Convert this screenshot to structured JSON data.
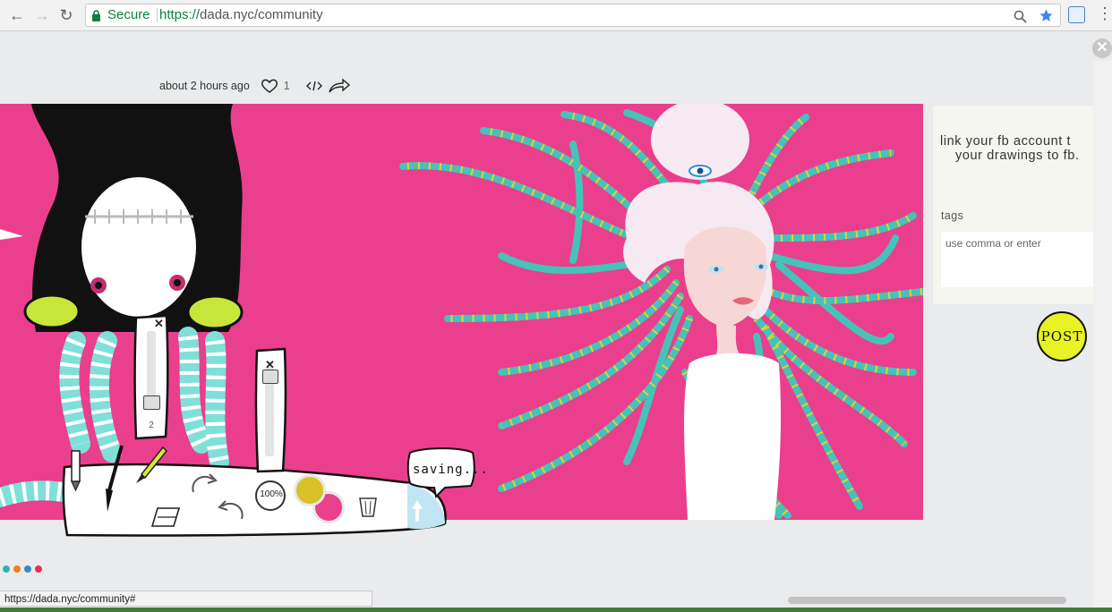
{
  "browser": {
    "secure_label": "Secure",
    "url_scheme": "https://",
    "url_host_path": "dada.nyc/community",
    "status_url": "https://dada.nyc/community#"
  },
  "post": {
    "time_ago": "about 2 hours ago",
    "like_count": "1"
  },
  "side_panel": {
    "fb_line1": "link your fb account t",
    "fb_line2": "your drawings to fb.",
    "tags_label": "tags",
    "tags_placeholder": "use comma or enter",
    "post_button": "POST"
  },
  "toolbar": {
    "saving_label": "saving...",
    "zoom_level": "100%",
    "brush_size": "2",
    "primary_color": "#d9c12a",
    "secondary_color": "#ea3f8c"
  },
  "colors": {
    "canvas_bg": "#ea3f8c",
    "tentacle": "#45c3b8",
    "tentacle_stripe": "#e6d12e",
    "secure_green": "#0b8043"
  },
  "palette_dots": [
    "#2cb5b5",
    "#f47c20",
    "#3b86c9",
    "#e8344e"
  ]
}
